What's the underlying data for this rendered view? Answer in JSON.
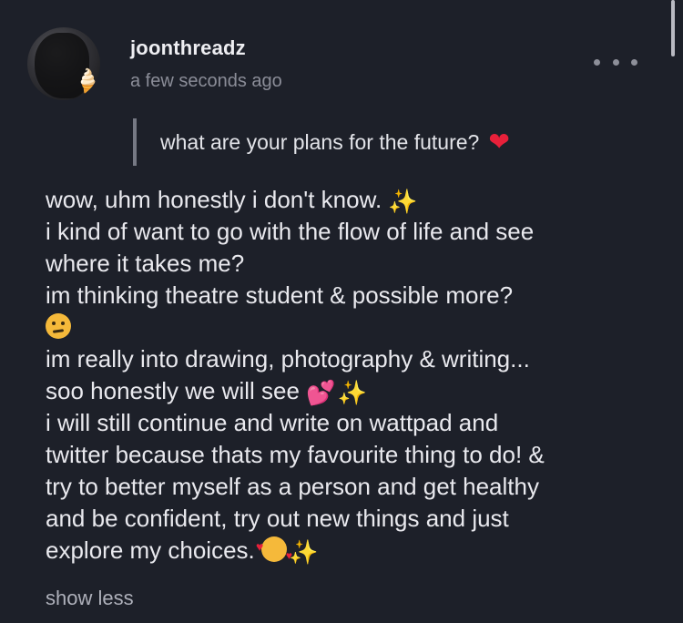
{
  "post": {
    "username": "joonthreadz",
    "timestamp": "a few seconds ago",
    "quote": "what are your plans for the future?",
    "lines": [
      "wow, uhm honestly i don't know.",
      "i kind of want to go with the flow of life and see",
      "where it takes me?",
      "im thinking theatre student & possible more?",
      "im really into drawing, photography & writing...",
      "soo honestly we will see",
      "i will still continue and write on wattpad and",
      "twitter because thats my favourite thing to do! &",
      "try to better myself as a person and get healthy",
      "and be confident, try out new things and just",
      "explore my choices."
    ],
    "show_less_label": "show less",
    "icons": {
      "avatar_emoji": "soft-ice-cream",
      "quote_emoji": "red-heart",
      "sparkles": "sparkles",
      "thinking": "thinking-face",
      "hearts": "two-hearts",
      "smiling_hearts": "smiling-face-with-hearts",
      "more": "more-dots"
    }
  },
  "colors": {
    "background": "#1d2029",
    "text": "#e9e9ee",
    "muted": "#8b8d98",
    "quote_bar": "#767984"
  }
}
